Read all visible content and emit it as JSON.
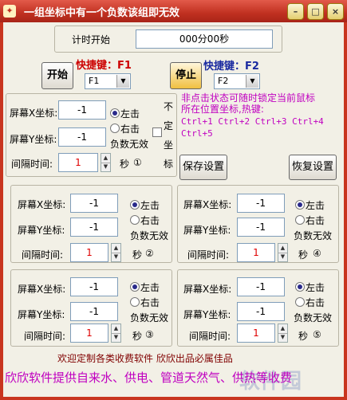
{
  "window": {
    "title": "一组坐标中有一个负数该组即无效",
    "min_glyph": "–",
    "max_glyph": "□",
    "close_glyph": "×"
  },
  "timer": {
    "label": "计时开始",
    "value": "000分00秒"
  },
  "controls": {
    "start_label": "开始",
    "stop_label": "停止",
    "hotkey1_title": "快捷键：F1",
    "hotkey1_value": "F1",
    "hotkey2_title": "快捷键：F2",
    "hotkey2_value": "F2",
    "hint_lines": [
      "非点击状态可随时锁定当前鼠标",
      "所在位置坐标,热键:",
      "Ctrl+1 Ctrl+2 Ctrl+3 Ctrl+4",
      "Ctrl+5"
    ],
    "save_label": "保存设置",
    "restore_label": "恢复设置",
    "unfixed_label": "不定坐标"
  },
  "labels": {
    "screen_x": "屏幕X坐标:",
    "screen_y": "屏幕Y坐标:",
    "interval": "间隔时间:",
    "left_click": "左击",
    "right_click": "右击",
    "negative_invalid": "负数无效",
    "seconds": "秒"
  },
  "groups": [
    {
      "x": "-1",
      "y": "-1",
      "interval": "1",
      "marker": "①"
    },
    {
      "x": "-1",
      "y": "-1",
      "interval": "1",
      "marker": "②"
    },
    {
      "x": "-1",
      "y": "-1",
      "interval": "1",
      "marker": "④"
    },
    {
      "x": "-1",
      "y": "-1",
      "interval": "1",
      "marker": "③"
    },
    {
      "x": "-1",
      "y": "-1",
      "interval": "1",
      "marker": "⑤"
    }
  ],
  "footer": {
    "slogan": "欢迎定制各类收费软件  欣欣出品必属佳品",
    "marquee": "欣欣软件提供自来水、供电、管道天然气、供热等收费",
    "watermark": "软件园"
  },
  "colors": {
    "title_bar": "#c03020",
    "hint": "#c000c0",
    "hotkey1": "#cc0000",
    "hotkey2": "#1a2aa0",
    "footer": "#800000"
  }
}
